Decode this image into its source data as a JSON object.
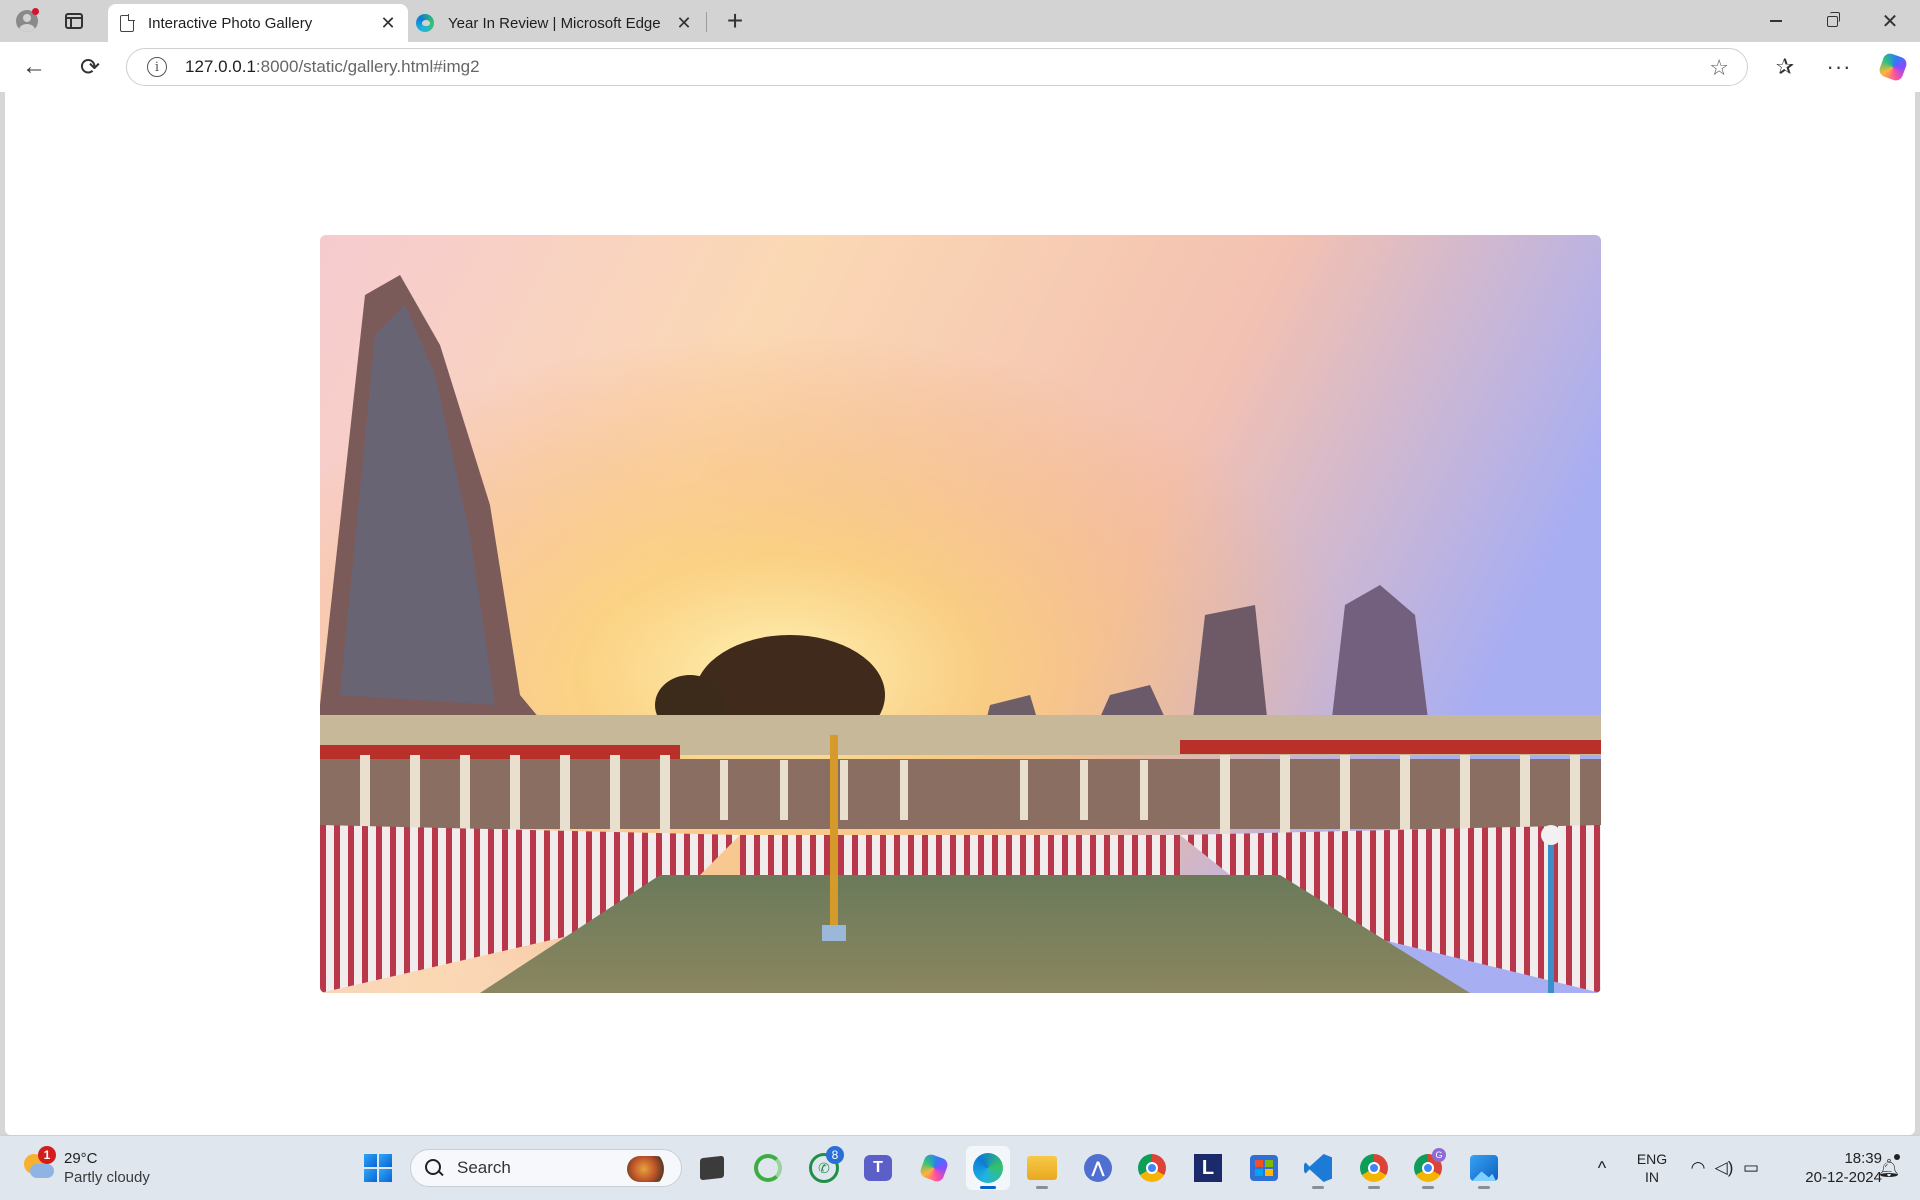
{
  "browser": {
    "tabs": [
      {
        "title": "Interactive Photo Gallery",
        "active": true,
        "icon": "page-icon"
      },
      {
        "title": "Year In Review | Microsoft Edge",
        "active": false,
        "icon": "edge-icon"
      }
    ],
    "address": {
      "host": "127.0.0.1",
      "path": ":8000/static/gallery.html#img2"
    },
    "icons": {
      "back": "←",
      "reload": "⟳",
      "info": "i",
      "star": "☆",
      "favorites": "✰",
      "more": "···",
      "close_tab": "✕",
      "new_tab": "+",
      "close_window": "✕"
    }
  },
  "page": {
    "image": {
      "alt": "Meenakshi temple tank at sunset",
      "current": "img2"
    }
  },
  "taskbar": {
    "weather": {
      "temp": "29°C",
      "condition": "Partly cloudy",
      "badge": "1"
    },
    "search": {
      "label": "Search"
    },
    "apps": [
      {
        "name": "start"
      },
      {
        "name": "file-viewer"
      },
      {
        "name": "chat-app"
      },
      {
        "name": "whatsapp",
        "badge": "8"
      },
      {
        "name": "teams"
      },
      {
        "name": "copilot"
      },
      {
        "name": "edge",
        "active": true
      },
      {
        "name": "file-explorer"
      },
      {
        "name": "app-a"
      },
      {
        "name": "chrome"
      },
      {
        "name": "l-app"
      },
      {
        "name": "store"
      },
      {
        "name": "vscode"
      },
      {
        "name": "chrome-2"
      },
      {
        "name": "chrome-profile"
      },
      {
        "name": "photos"
      }
    ],
    "tray": {
      "lang_line1": "ENG",
      "lang_line2": "IN",
      "time": "18:39",
      "date": "20-12-2024",
      "chevron": "^"
    }
  }
}
